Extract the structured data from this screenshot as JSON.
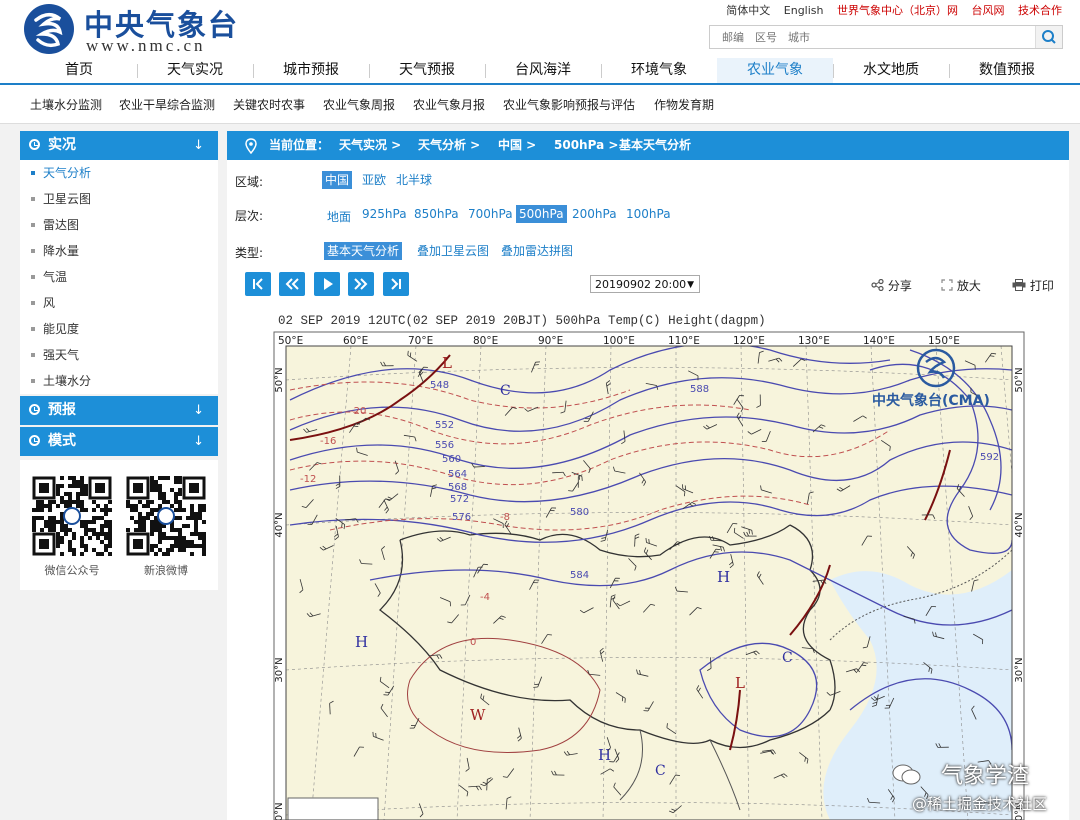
{
  "header": {
    "site_title": "中央气象台",
    "site_url": "www.nmc.cn",
    "top_links": [
      {
        "label": "简体中文",
        "color": "#333333"
      },
      {
        "label": "English",
        "color": "#333333"
      },
      {
        "label": "世界气象中心（北京）网",
        "color": "#cc0000"
      },
      {
        "label": "台风网",
        "color": "#cc0000"
      },
      {
        "label": "技术合作",
        "color": "#cc0000"
      }
    ],
    "search_placeholder": "邮编　区号　城市"
  },
  "main_nav": [
    {
      "label": "首页",
      "active": false
    },
    {
      "label": "天气实况",
      "active": false
    },
    {
      "label": "城市预报",
      "active": false
    },
    {
      "label": "天气预报",
      "active": false
    },
    {
      "label": "台风海洋",
      "active": false
    },
    {
      "label": "环境气象",
      "active": false
    },
    {
      "label": "农业气象",
      "active": true
    },
    {
      "label": "水文地质",
      "active": false
    },
    {
      "label": "数值预报",
      "active": false
    }
  ],
  "sub_nav": [
    "土壤水分监测",
    "农业干旱综合监测",
    "关键农时农事",
    "农业气象周报",
    "农业气象月报",
    "农业气象影响预报与评估",
    "作物发育期"
  ],
  "sidebar": {
    "sections": [
      {
        "title": "实况",
        "arrow": "↓",
        "items": [
          "天气分析",
          "卫星云图",
          "雷达图",
          "降水量",
          "气温",
          "风",
          "能见度",
          "强天气",
          "土壤水分"
        ],
        "active_index": 0
      },
      {
        "title": "预报",
        "arrow": "↓",
        "items": []
      },
      {
        "title": "模式",
        "arrow": "↓",
        "items": []
      }
    ],
    "qr_codes": [
      "微信公众号",
      "新浪微博"
    ]
  },
  "breadcrumb": [
    "当前位置：",
    "天气实况 >",
    "天气分析 >",
    "中国 >",
    "500hPa >",
    "基本天气分析"
  ],
  "filters": {
    "region": {
      "label": "区域:",
      "options": [
        "中国",
        "亚欧",
        "北半球"
      ],
      "selected": 0
    },
    "level": {
      "label": "层次:",
      "options": [
        "地面",
        "925hPa",
        "850hPa",
        "700hPa",
        "500hPa",
        "200hPa",
        "100hPa"
      ],
      "selected": 4
    },
    "type": {
      "label": "类型:",
      "options": [
        "基本天气分析",
        "叠加卫星云图",
        "叠加雷达拼图"
      ],
      "selected": 0
    }
  },
  "player": {
    "controls": [
      "first-frame",
      "previous-frame",
      "play",
      "next-frame",
      "last-frame"
    ],
    "time_value": "20190902 20:00",
    "tools": [
      "分享",
      "放大",
      "打印"
    ]
  },
  "map": {
    "title": "02  SEP 2019 12UTC(02  SEP 2019 20BJT) 500hPa Temp(C) Height(dagpm)",
    "lon_labels": [
      "50°E",
      "60°E",
      "70°E",
      "80°E",
      "90°E",
      "100°E",
      "110°E",
      "120°E",
      "130°E",
      "140°E",
      "150°E"
    ],
    "lat_labels": [
      "50°N",
      "40°N",
      "30°N",
      "20°N"
    ],
    "watermark": "中央气象台(CMA)",
    "height_labels": [
      "548",
      "552",
      "556",
      "560",
      "564",
      "568",
      "572",
      "576",
      "580",
      "584",
      "588",
      "592"
    ],
    "temp_labels": [
      "-20",
      "-16",
      "-12",
      "-8",
      "-4",
      "0"
    ],
    "centers": [
      "L",
      "C",
      "H",
      "H",
      "C",
      "L",
      "W",
      "H",
      "C"
    ],
    "colors": {
      "height": "#4a4ab0",
      "temp": "#c05050",
      "trough": "#7a1010",
      "land": "#f7f4dc",
      "sea": "#dfeefa"
    }
  },
  "overlay": {
    "wechat_text": "气象学渣",
    "corner_text": "@稀土掘金技术社区"
  },
  "colors": {
    "accent": "#1d8fd8",
    "link": "#1d7fc8",
    "selected_bg": "#3b8fd8"
  }
}
